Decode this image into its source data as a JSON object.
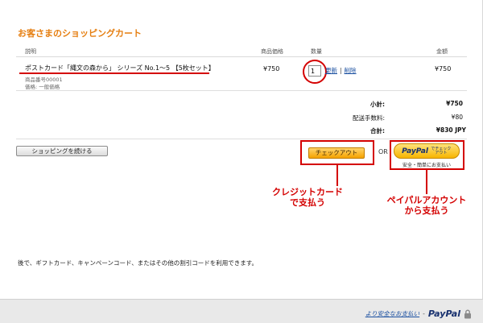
{
  "page": {
    "title": "お客さまのショッピングカート"
  },
  "table": {
    "headers": {
      "description": "説明",
      "unit_price": "商品価格",
      "quantity": "数量",
      "amount": "金額"
    }
  },
  "item": {
    "name": "ポストカード「縄文の森から」 シリーズ No.1〜5 【5枚セット】",
    "product_number": "商品番号00001",
    "price_note": "価格: 一般価格",
    "unit_price": "¥750",
    "quantity": "1",
    "update_label": "更新",
    "delete_label": "削除",
    "amount": "¥750"
  },
  "summary": {
    "subtotal_label": "小計:",
    "subtotal_value": "¥750",
    "shipping_label": "配送手数料:",
    "shipping_value": "¥80",
    "total_label": "合計:",
    "total_value": "¥830 JPY"
  },
  "actions": {
    "continue_label": "ショッピングを続ける",
    "checkout_label": "チェックアウト",
    "or_label": "OR",
    "paypal_logo_pay": "PayPal",
    "paypal_small": "でチェックアウト",
    "paypal_sub": "安全・簡単にお支払い"
  },
  "annotations": {
    "credit_line1": "クレジットカード",
    "credit_line2": "で支払う",
    "paypal_line1": "ペイパルアカウント",
    "paypal_line2": "から支払う"
  },
  "footer": {
    "note": "後で、ギフトカード、キャンペーンコード、またはその他の割引コードを利用できます。",
    "secure_link": "より安全なお支払い",
    "paypal_word": "PayPal"
  },
  "colors": {
    "accent_orange": "#e57e10",
    "annotation_red": "#d40000",
    "link_blue": "#1a4fa0"
  },
  "icons": {
    "secure": "lock-icon"
  }
}
